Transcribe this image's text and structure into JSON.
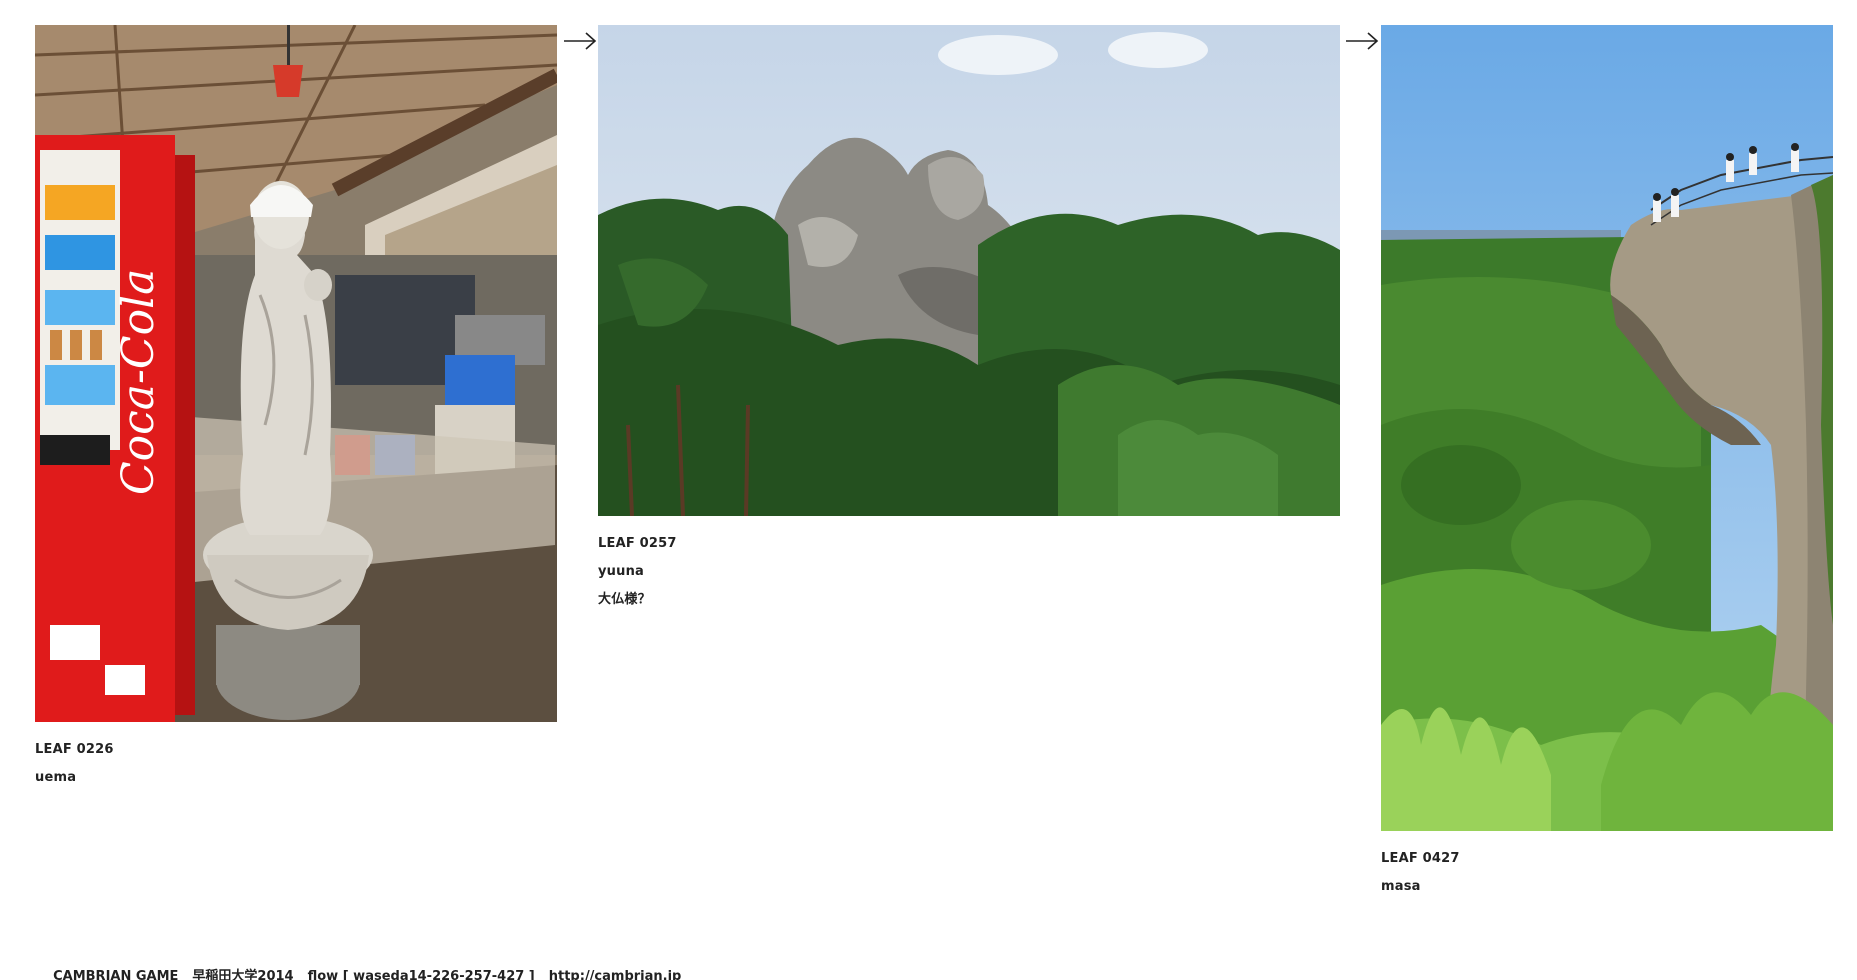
{
  "leaves": [
    {
      "id": "LEAF 0226",
      "user": "uema",
      "caption": "",
      "photo_icon": "jizo-statue-vending-machine-photo"
    },
    {
      "id": "LEAF 0257",
      "user": "yuuna",
      "caption": "大仏様？",
      "photo_icon": "rock-peak-forest-photo"
    },
    {
      "id": "LEAF 0427",
      "user": "masa",
      "caption": "",
      "photo_icon": "cliff-overlook-valley-photo"
    }
  ],
  "arrow_icon": "right-arrow-icon",
  "footer": {
    "brand": "CAMBRIAN GAME",
    "university": "早稲田大学2014",
    "flow": "flow [ waseda14-226-257-427 ]",
    "link": "http://cambrian.jp"
  },
  "colors": {
    "sky": "#c9dff3",
    "forest": "#2f6b2c",
    "coke_red": "#e01b1b"
  }
}
